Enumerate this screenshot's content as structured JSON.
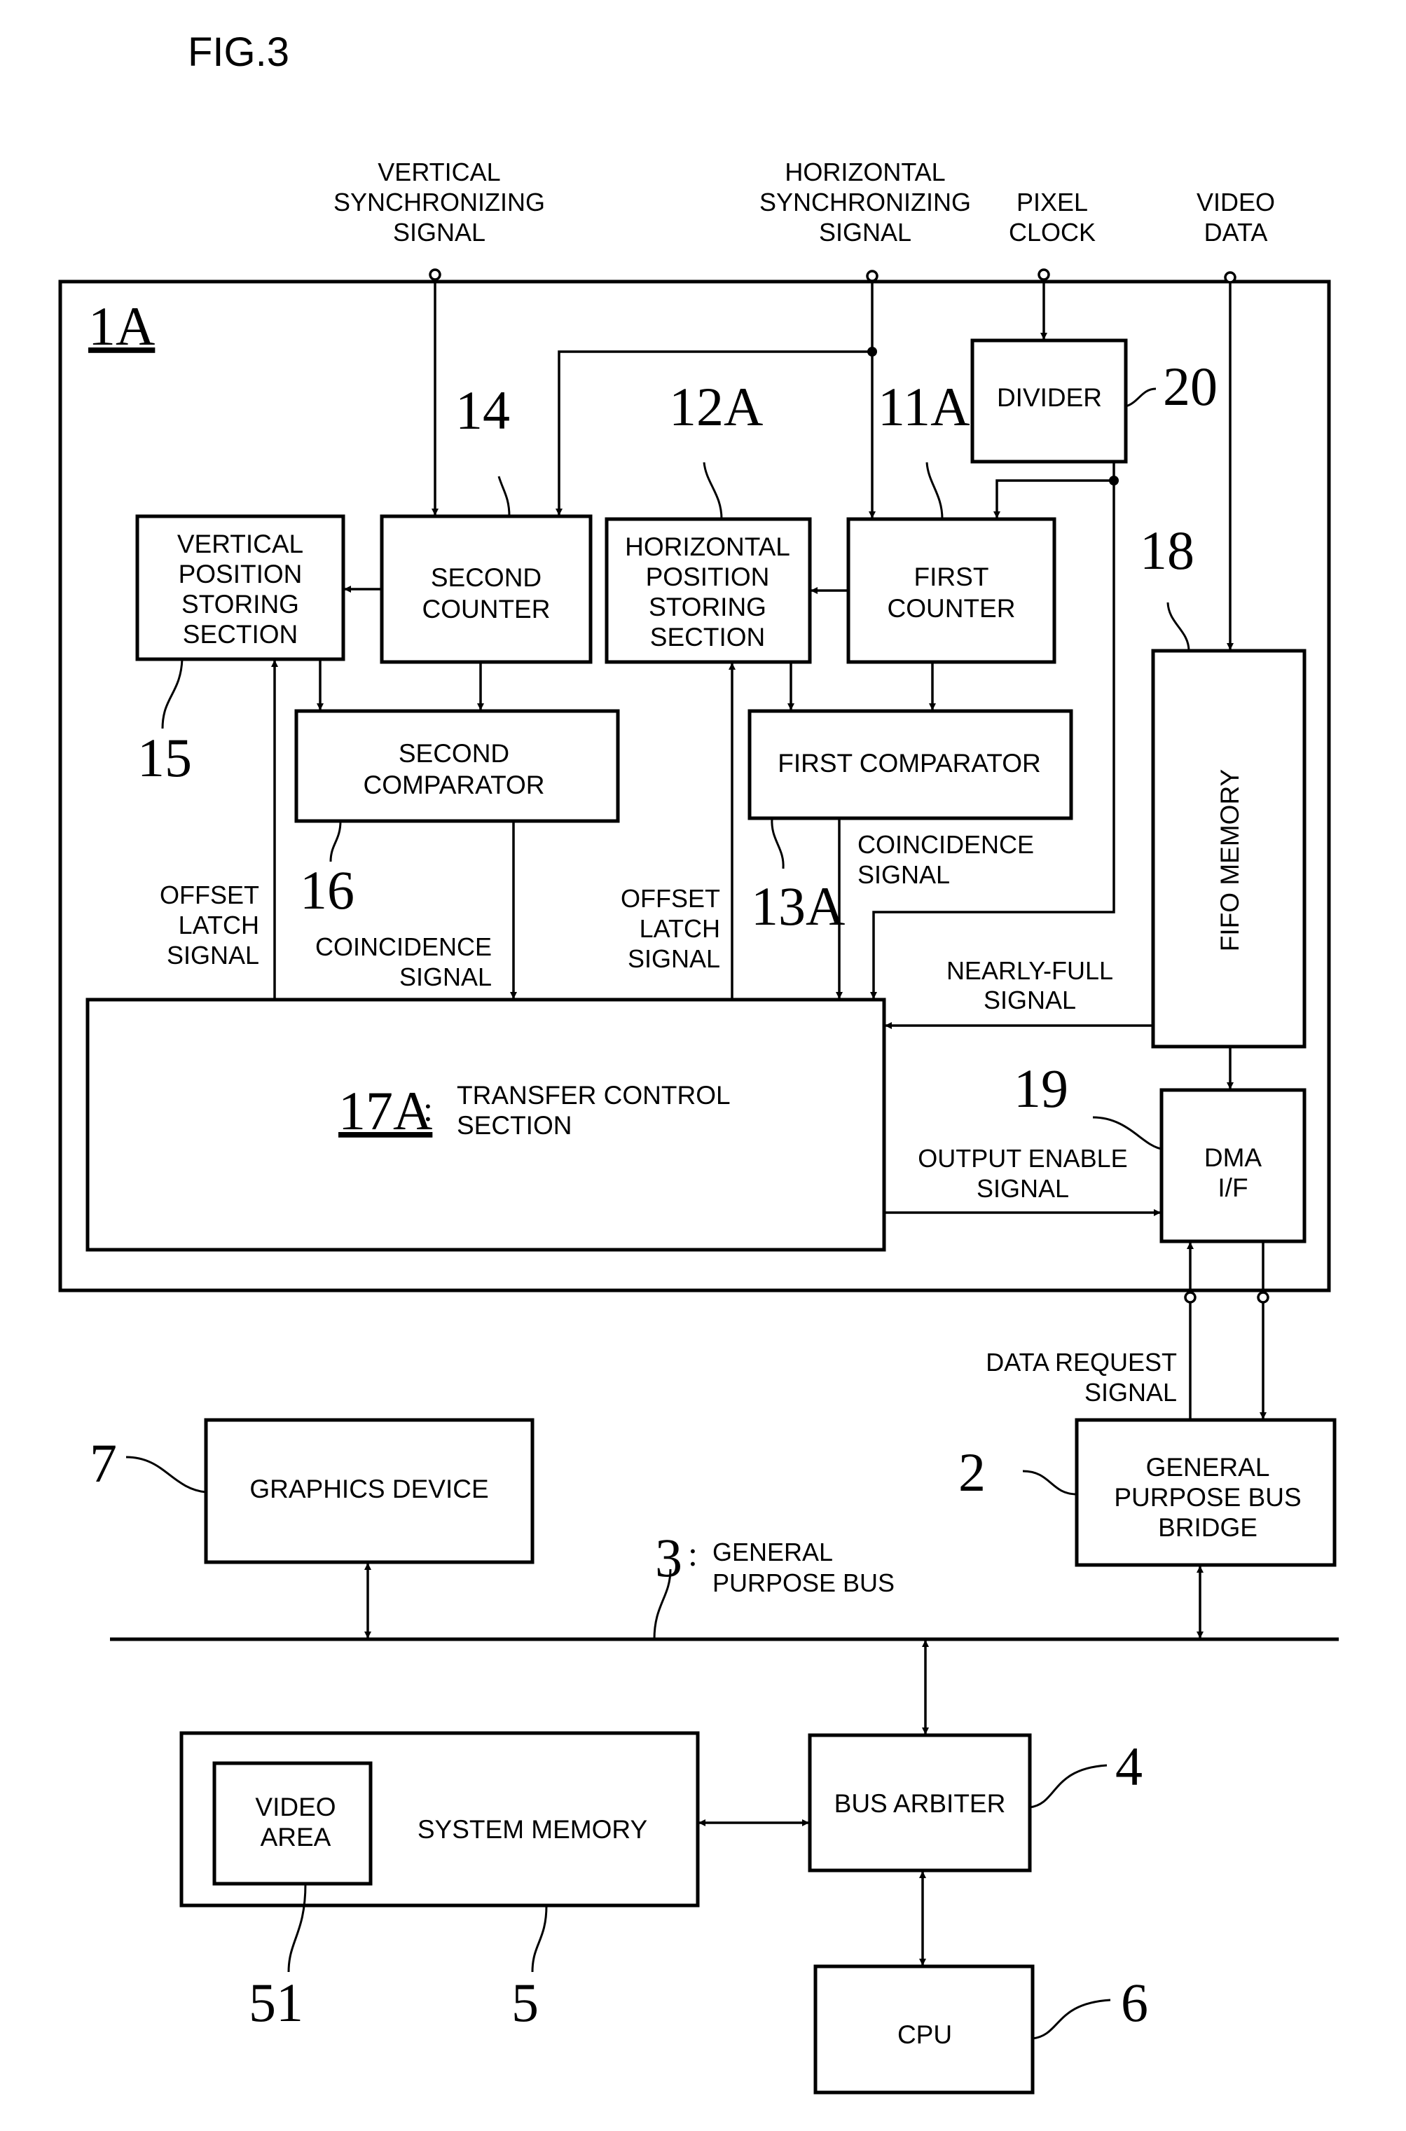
{
  "figure_title": "FIG.3",
  "inputs": {
    "vertical_sync": [
      "VERTICAL",
      "SYNCHRONIZING",
      "SIGNAL"
    ],
    "horizontal_sync": [
      "HORIZONTAL",
      "SYNCHRONIZING",
      "SIGNAL"
    ],
    "pixel_clock": [
      "PIXEL",
      "CLOCK"
    ],
    "video_data": [
      "VIDEO",
      "DATA"
    ]
  },
  "device": {
    "ref": "1A"
  },
  "blocks": {
    "divider": {
      "ref": "20",
      "lines": [
        "DIVIDER"
      ]
    },
    "vertical_position_storing": {
      "ref": "15",
      "lines": [
        "VERTICAL",
        "POSITION",
        "STORING",
        "SECTION"
      ]
    },
    "second_counter": {
      "ref": "14",
      "lines": [
        "SECOND",
        "COUNTER"
      ]
    },
    "horizontal_position_storing": {
      "ref": "12A",
      "lines": [
        "HORIZONTAL",
        "POSITION",
        "STORING",
        "SECTION"
      ]
    },
    "first_counter": {
      "ref": "11A",
      "lines": [
        "FIRST",
        "COUNTER"
      ]
    },
    "second_comparator": {
      "ref": "16",
      "lines": [
        "SECOND",
        "COMPARATOR"
      ]
    },
    "first_comparator": {
      "ref": "13A",
      "lines": [
        "FIRST COMPARATOR"
      ]
    },
    "fifo_memory": {
      "ref": "18",
      "lines": [
        "FIFO MEMORY"
      ]
    },
    "transfer_control": {
      "ref": "17A",
      "separator": ":",
      "lines": [
        "TRANSFER CONTROL",
        "SECTION"
      ]
    },
    "dma_if": {
      "ref": "19",
      "lines": [
        "DMA",
        "I/F"
      ]
    },
    "bus_bridge": {
      "ref": "2",
      "lines": [
        "GENERAL",
        "PURPOSE BUS",
        "BRIDGE"
      ]
    },
    "graphics_device": {
      "ref": "7",
      "lines": [
        "GRAPHICS DEVICE"
      ]
    },
    "system_memory": {
      "ref": "5",
      "lines": [
        "SYSTEM MEMORY"
      ]
    },
    "video_area": {
      "ref": "51",
      "lines": [
        "VIDEO",
        "AREA"
      ]
    },
    "bus_arbiter": {
      "ref": "4",
      "lines": [
        "BUS ARBITER"
      ]
    },
    "cpu": {
      "ref": "6",
      "lines": [
        "CPU"
      ]
    }
  },
  "bus": {
    "ref": "3",
    "separator": ":",
    "lines": [
      "GENERAL",
      "PURPOSE BUS"
    ]
  },
  "signals": {
    "offset_latch_left": [
      "OFFSET",
      "LATCH",
      "SIGNAL"
    ],
    "offset_latch_right": [
      "OFFSET",
      "LATCH",
      "SIGNAL"
    ],
    "coincidence_second": [
      "COINCIDENCE",
      "SIGNAL"
    ],
    "coincidence_first": [
      "COINCIDENCE",
      "SIGNAL"
    ],
    "nearly_full": [
      "NEARLY-FULL",
      "SIGNAL"
    ],
    "output_enable": [
      "OUTPUT ENABLE",
      "SIGNAL"
    ],
    "data_request": [
      "DATA REQUEST",
      "SIGNAL"
    ]
  }
}
